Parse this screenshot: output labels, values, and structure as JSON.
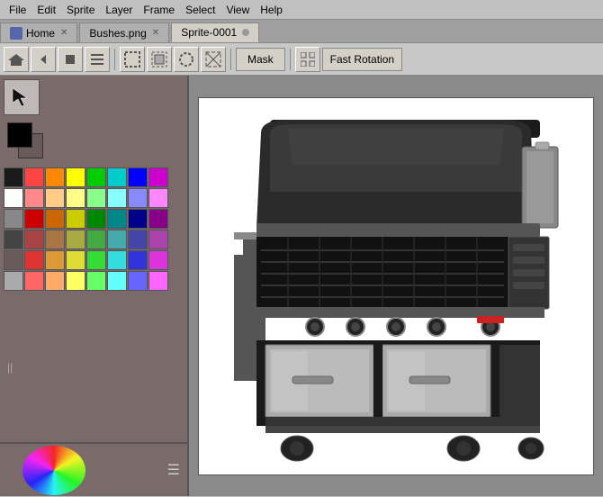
{
  "menubar": {
    "items": [
      {
        "label": "File",
        "id": "menu-file"
      },
      {
        "label": "Edit",
        "id": "menu-edit"
      },
      {
        "label": "Sprite",
        "id": "menu-sprite"
      },
      {
        "label": "Layer",
        "id": "menu-layer"
      },
      {
        "label": "Frame",
        "id": "menu-frame"
      },
      {
        "label": "Select",
        "id": "menu-select"
      },
      {
        "label": "View",
        "id": "menu-view"
      },
      {
        "label": "Help",
        "id": "menu-help"
      }
    ]
  },
  "tabs": {
    "items": [
      {
        "label": "Home",
        "id": "tab-home",
        "active": false,
        "hasClose": true
      },
      {
        "label": "Bushes.png",
        "id": "tab-bushes",
        "active": false,
        "hasClose": true
      },
      {
        "label": "Sprite-0001",
        "id": "tab-sprite",
        "active": true,
        "hasClose": false
      }
    ]
  },
  "toolbar": {
    "mask_label": "Mask",
    "fast_rotation_label": "Fast Rotation"
  },
  "palette": {
    "colors": [
      "#1a1a1a",
      "#ff4444",
      "#ff8800",
      "#ffff00",
      "#00cc00",
      "#00cccc",
      "#0000ff",
      "#cc00cc",
      "#ffffff",
      "#ff8888",
      "#ffcc88",
      "#ffff88",
      "#88ff88",
      "#88ffff",
      "#8888ff",
      "#ff88ff",
      "#888888",
      "#cc0000",
      "#cc6600",
      "#cccc00",
      "#008800",
      "#008888",
      "#000088",
      "#880088",
      "#444444",
      "#aa4444",
      "#aa7744",
      "#aaaa44",
      "#44aa44",
      "#44aaaa",
      "#4444aa",
      "#aa44aa",
      "#6a5a5a",
      "#dd3333",
      "#dd9933",
      "#dddd33",
      "#33dd33",
      "#33dddd",
      "#3333dd",
      "#dd33dd",
      "#aaaaaa",
      "#ff6666",
      "#ffaa66",
      "#ffff66",
      "#66ff66",
      "#66ffff",
      "#6666ff",
      "#ff66ff"
    ]
  },
  "status": {
    "coords": "||"
  },
  "canvas": {
    "bg_color": "#ffffff"
  }
}
